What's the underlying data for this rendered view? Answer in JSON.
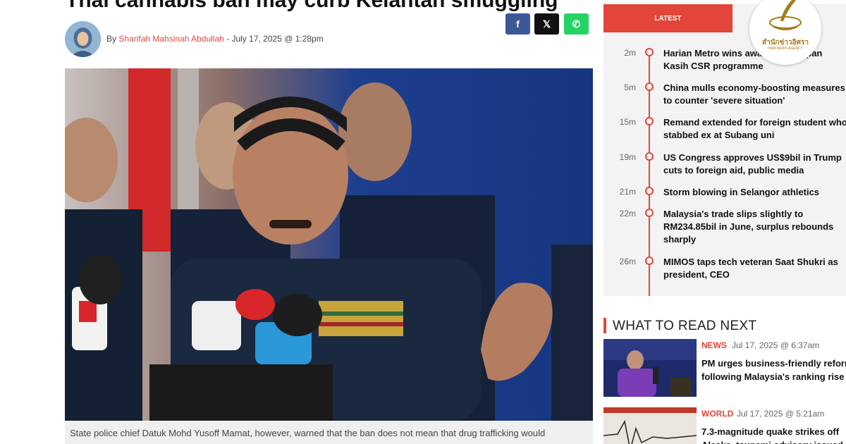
{
  "article": {
    "headline": "Thai cannabis ban may curb Kelantan smuggling",
    "byline_prefix": "By",
    "author": "Sharifah Mahsinah Abdullah",
    "date": "- July 17, 2025 @ 1:28pm",
    "share": {
      "facebook": "f",
      "x": "𝕏",
      "whatsapp": "✆"
    },
    "caption": "State police chief Datuk Mohd Yusoff Mamat, however, warned that the ban does not mean that drug trafficking would"
  },
  "sidebar": {
    "tab_latest": "LATEST",
    "logo": {
      "thai": "สำนักข่าวอิศรา",
      "english": "ISRA NEWS AGENCY"
    },
    "latest": [
      {
        "time": "2m",
        "title": "Harian Metro wins award for Dulipan Kasih CSR programme"
      },
      {
        "time": "5m",
        "title": "China mulls economy-boosting measures to counter 'severe situation'"
      },
      {
        "time": "15m",
        "title": "Remand extended for foreign student who stabbed ex at Subang uni"
      },
      {
        "time": "19m",
        "title": "US Congress approves US$9bil in Trump cuts to foreign aid, public media"
      },
      {
        "time": "21m",
        "title": "Storm blowing in Selangor athletics"
      },
      {
        "time": "22m",
        "title": "Malaysia's trade slips slightly to RM234.85bil in June, surplus rebounds sharply"
      },
      {
        "time": "26m",
        "title": "MIMOS taps tech veteran Saat Shukri as president, CEO"
      }
    ]
  },
  "read_next": {
    "heading": "WHAT TO READ NEXT",
    "items": [
      {
        "category": "NEWS",
        "date": "Jul 17, 2025 @ 6:37am",
        "title_line1": "PM urges business-friendly reforms",
        "title_line2": "following Malaysia's ranking rise"
      },
      {
        "category": "WORLD",
        "date": "Jul 17, 2025 @ 5:21am",
        "title_line1": "7.3-magnitude quake strikes off",
        "title_line2": "Alaska, tsunami advisory issued"
      }
    ]
  },
  "colors": {
    "accent": "#e3453a",
    "facebook": "#3b5998",
    "x": "#111111",
    "whatsapp": "#25d366"
  }
}
